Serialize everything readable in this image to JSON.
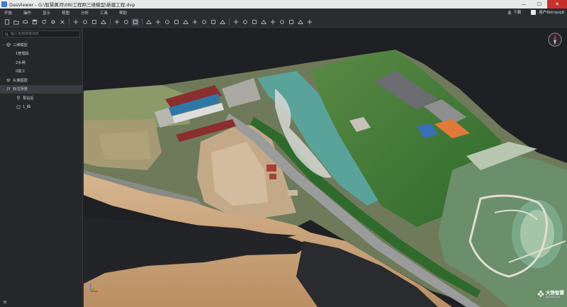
{
  "window": {
    "title": "DasViewer - G:\\智慧黄河\\0B)工程照三维模型\\新建工程.dvp",
    "minimize": "—",
    "maximize": "☐",
    "close": "✕"
  },
  "menu": {
    "items": [
      "开始",
      "操作",
      "显示",
      "视图",
      "分析",
      "工具",
      "帮助"
    ],
    "download_label": "下载",
    "user_name": "用户6ktrqvq8"
  },
  "toolbar": {
    "icons": [
      "new-file-icon",
      "open-folder-icon",
      "cloud-upload-icon",
      "save-icon",
      "refresh-icon",
      "settings-icon",
      "close-icon",
      "move-icon",
      "select-icon",
      "zoom-region-icon",
      "measure-icon",
      "model-icon",
      "terrain-icon",
      "point-cloud-icon",
      "monitor-icon",
      "height-icon",
      "light-icon",
      "layer-icon",
      "grid-icon",
      "box-icon",
      "globe-icon",
      "clip-icon",
      "video-icon",
      "flag-icon",
      "image-icon",
      "contrast-icon",
      "location-icon",
      "compare-icon",
      "profile-icon",
      "cut-icon",
      "fill-icon",
      "capture-icon"
    ]
  },
  "sidebar": {
    "search_placeholder": "输入名称搜索场景",
    "tree": [
      {
        "label": "三维模型",
        "icon": "cube-icon",
        "level": 0,
        "expanded": true
      },
      {
        "label": "1管理段",
        "level": 1
      },
      {
        "label": "2水闸",
        "level": 1
      },
      {
        "label": "0取工",
        "level": 1
      },
      {
        "label": "矢量图层",
        "icon": "vector-layer-icon",
        "level": 0,
        "expanded": false
      },
      {
        "label": "标注场景",
        "icon": "flag-icon",
        "level": 0,
        "expanded": true,
        "selected": true
      },
      {
        "label": "泵站后",
        "icon": "pin-icon",
        "level": 1
      },
      {
        "label": "1_曲",
        "icon": "frame-icon",
        "level": 1
      }
    ]
  },
  "viewport": {
    "brand_cn": "大势智慧",
    "brand_en": "DASPATIAL",
    "colors": {
      "background": "#1f2023",
      "sand": "#c9a27a",
      "vegetation": "#3f7a35",
      "road": "#8c8e8f",
      "water_slope": "#5aa39a"
    }
  }
}
